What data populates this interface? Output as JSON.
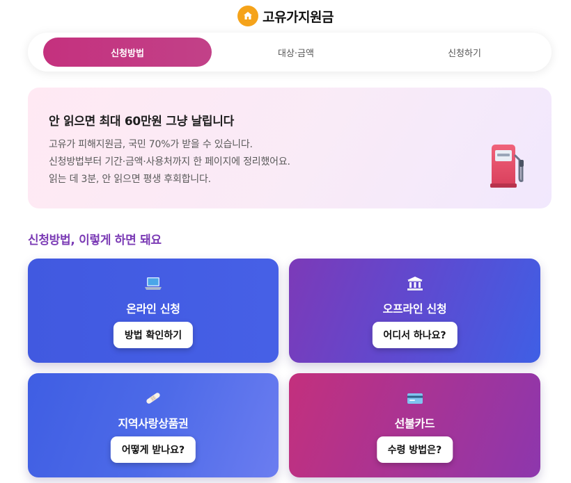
{
  "header": {
    "title": "고유가지원금",
    "logo_icon": "house-icon"
  },
  "tabs": [
    {
      "label": "신청방법",
      "active": true
    },
    {
      "label": "대상·금액",
      "active": false
    },
    {
      "label": "신청하기",
      "active": false
    }
  ],
  "hero": {
    "title": "안 읽으면 최대 60만원 그냥 날립니다",
    "lines": [
      "고유가 피해지원금, 국민 70%가 받을 수 있습니다.",
      "신청방법부터 기간·금액·사용처까지 한 페이지에 정리했어요.",
      "읽는 데 3분, 안 읽으면 평생 후회합니다."
    ],
    "illustration_icon": "fuel-pump-icon"
  },
  "section": {
    "title": "신청방법, 이렇게 하면 돼요"
  },
  "cards": [
    {
      "icon": "laptop-icon",
      "title": "온라인 신청",
      "button": "방법 확인하기"
    },
    {
      "icon": "bank-icon",
      "title": "오프라인 신청",
      "button": "어디서 하나요?"
    },
    {
      "icon": "bandage-icon",
      "title": "지역사랑상품권",
      "button": "어떻게 받나요?"
    },
    {
      "icon": "credit-card-icon",
      "title": "선불카드",
      "button": "수령 방법은?"
    }
  ],
  "colors": {
    "active_tab": "#c4317e",
    "section_title": "#7b3bb5",
    "logo": "#f5a31a",
    "card_blue": "#4159e0",
    "card_purple": "#7c3ab8",
    "card_magenta": "#c3307d"
  }
}
